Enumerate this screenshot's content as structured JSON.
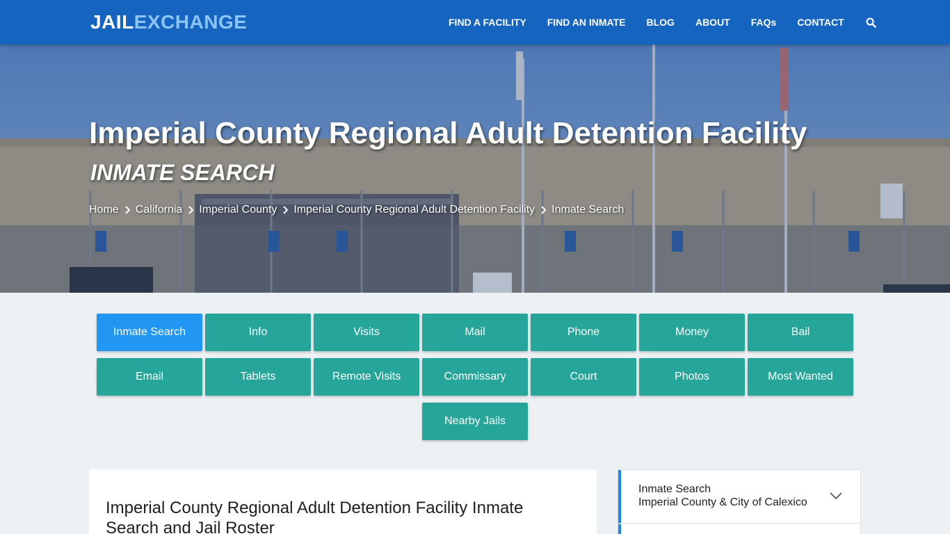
{
  "brand": {
    "part1": "JAIL",
    "part2": "EXCHANGE"
  },
  "nav": [
    "FIND A FACILITY",
    "FIND AN INMATE",
    "BLOG",
    "ABOUT",
    "FAQs",
    "CONTACT"
  ],
  "hero": {
    "title": "Imperial County Regional Adult Detention Facility",
    "subtitle": "INMATE SEARCH",
    "breadcrumb": [
      "Home",
      "California",
      "Imperial County",
      "Imperial County Regional Adult Detention Facility",
      "Inmate Search"
    ]
  },
  "tabs": [
    "Inmate Search",
    "Info",
    "Visits",
    "Mail",
    "Phone",
    "Money",
    "Bail",
    "Email",
    "Tablets",
    "Remote Visits",
    "Commissary",
    "Court",
    "Photos",
    "Most Wanted",
    "Nearby Jails"
  ],
  "active_tab": "Inmate Search",
  "content": {
    "heading": "Imperial County Regional Adult Detention Facility Inmate Search and Jail Roster"
  },
  "sidebar": {
    "item1_line1": "Inmate Search",
    "item1_line2": "Imperial County & City of Calexico"
  },
  "colors": {
    "navbar": "#1565c0",
    "tab": "#26a69a",
    "tab_active": "#2196f3",
    "accent": "#1e88e5"
  },
  "icons": {
    "search": "search-icon",
    "breadcrumb_separator": "chevron-right-icon",
    "accordion": "chevron-down-icon"
  }
}
